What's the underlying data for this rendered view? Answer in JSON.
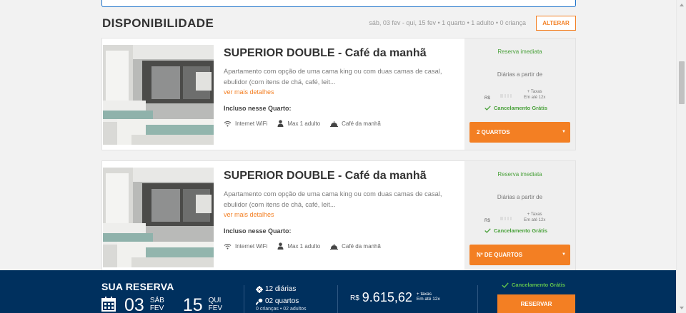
{
  "availability": {
    "heading": "DISPONIBILIDADE",
    "search_summary": "sáb, 03 fev - qui, 15 fev • 1 quarto • 1 adulto • 0 criança",
    "change_label": "ALTERAR"
  },
  "rooms": [
    {
      "title": "SUPERIOR DOUBLE - Café da manhã",
      "description": "Apartamento com opção de uma cama king ou com duas camas de casal, ebulidor (com itens de chá, café, leit...",
      "more_link": "ver mais detalhes",
      "included_label": "Incluso nesse Quarto:",
      "amenities": [
        "Internet WiFi",
        "Max 1 adulto",
        "Café da manhã"
      ],
      "booking": "Reserva imediata",
      "from_label": "Diárias a partir de",
      "currency": "R$",
      "taxes": "+ Taxas",
      "installments": "Em até 12x",
      "cancellation": "Cancelamento Grátis",
      "rooms_select": "2 QUARTOS",
      "caret": "▼"
    },
    {
      "title": "SUPERIOR DOUBLE - Café da manhã",
      "description": "Apartamento com opção de uma cama king ou com duas camas de casal, ebulidor (com itens de chá, café, leit...",
      "more_link": "ver mais detalhes",
      "included_label": "Incluso nesse Quarto:",
      "amenities": [
        "Internet WiFi",
        "Max 1 adulto",
        "Café da manhã"
      ],
      "booking": "Reserva imediata",
      "from_label": "Diárias a partir de",
      "currency": "R$",
      "taxes": "+ Taxas",
      "installments": "Em até 12x",
      "cancellation": "Cancelamento Grátis",
      "rooms_select": "Nº DE QUARTOS",
      "caret": "▼"
    }
  ],
  "reservation": {
    "title": "SUA RESERVA",
    "checkin_day": "03",
    "checkin_dow": "SÁB",
    "checkin_month": "FEV",
    "checkout_day": "15",
    "checkout_dow": "QUI",
    "checkout_month": "FEV",
    "nights": "12 diárias",
    "rooms": "02 quartos",
    "guests": "0 crianças • 02 adultos",
    "currency": "R$",
    "total": "9.615,62",
    "taxes": "+ taxas",
    "installments": "Em até 12x",
    "cancellation": "Cancelamento Grátis",
    "reserve_label": "RESERVAR"
  },
  "colors": {
    "accent": "#f37f23",
    "navy": "#00305e",
    "success": "#4aa13b"
  }
}
